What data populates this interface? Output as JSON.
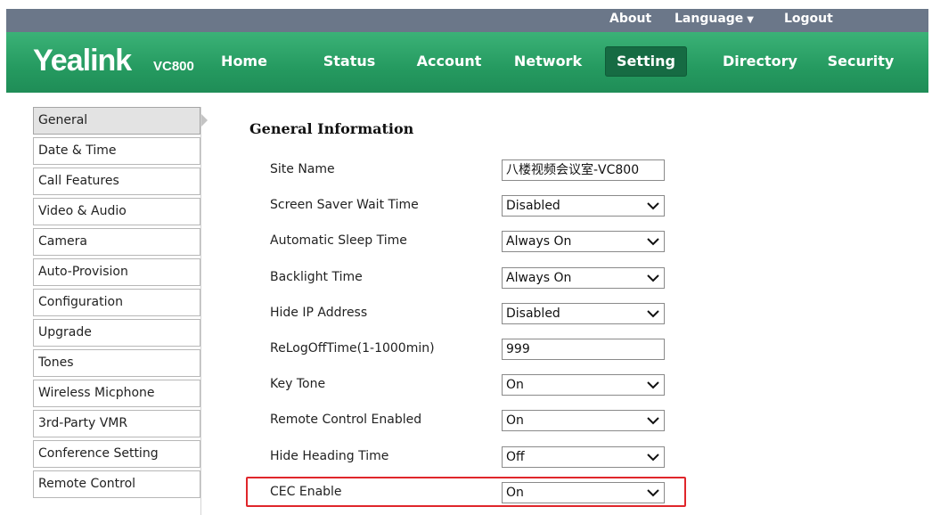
{
  "topbar": {
    "about": "About",
    "language": "Language",
    "logout": "Logout"
  },
  "brand": {
    "logo": "Yealink",
    "model": "VC800"
  },
  "nav": [
    "Home",
    "Status",
    "Account",
    "Network",
    "Setting",
    "Directory",
    "Security"
  ],
  "nav_active": "Setting",
  "sidebar": [
    "General",
    "Date & Time",
    "Call Features",
    "Video & Audio",
    "Camera",
    "Auto-Provision",
    "Configuration",
    "Upgrade",
    "Tones",
    "Wireless Micphone",
    "3rd-Party VMR",
    "Conference Setting",
    "Remote Control"
  ],
  "sidebar_active": "General",
  "section": {
    "title": "General Information"
  },
  "fields": [
    {
      "label": "Site Name",
      "value": "八楼视频会议室-VC800",
      "type": "text"
    },
    {
      "label": "Screen Saver Wait Time",
      "value": "Disabled",
      "type": "select"
    },
    {
      "label": "Automatic Sleep Time",
      "value": "Always On",
      "type": "select"
    },
    {
      "label": "Backlight Time",
      "value": "Always On",
      "type": "select"
    },
    {
      "label": "Hide IP Address",
      "value": "Disabled",
      "type": "select"
    },
    {
      "label": "ReLogOffTime(1-1000min)",
      "value": "999",
      "type": "text"
    },
    {
      "label": "Key Tone",
      "value": "On",
      "type": "select"
    },
    {
      "label": "Remote Control Enabled",
      "value": "On",
      "type": "select"
    },
    {
      "label": "Hide Heading Time",
      "value": "Off",
      "type": "select"
    },
    {
      "label": "CEC Enable",
      "value": "On",
      "type": "select"
    }
  ],
  "colors": {
    "nav_green": "#259a60",
    "nav_active": "#166b43",
    "top_strip": "#6b7789",
    "highlight": "#e0262b"
  }
}
